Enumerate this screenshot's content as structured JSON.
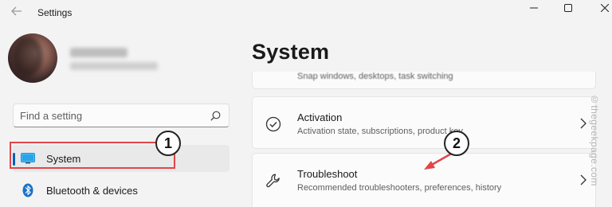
{
  "window": {
    "title": "Settings",
    "back_icon": "arrow-left-icon",
    "controls": [
      "minimize-icon",
      "maximize-icon",
      "close-icon"
    ]
  },
  "search": {
    "placeholder": "Find a setting",
    "icon": "search-icon"
  },
  "sidebar": {
    "items": [
      {
        "label": "System",
        "icon": "monitor-icon",
        "selected": true
      },
      {
        "label": "Bluetooth & devices",
        "icon": "bluetooth-icon",
        "selected": false
      }
    ]
  },
  "main": {
    "page_title": "System",
    "partial_card": {
      "subtitle": "Snap windows, desktops, task switching"
    },
    "cards": [
      {
        "title": "Activation",
        "subtitle": "Activation state, subscriptions, product key",
        "icon": "checkmark-circle-icon"
      },
      {
        "title": "Troubleshoot",
        "subtitle": "Recommended troubleshooters, preferences, history",
        "icon": "wrench-icon"
      }
    ]
  },
  "annotations": {
    "step1": "1",
    "step2": "2"
  },
  "watermark": "©thegeekpage.com",
  "colors": {
    "accent": "#005fb8",
    "annotation_red": "#e0474a",
    "background": "#f3f3f3"
  }
}
